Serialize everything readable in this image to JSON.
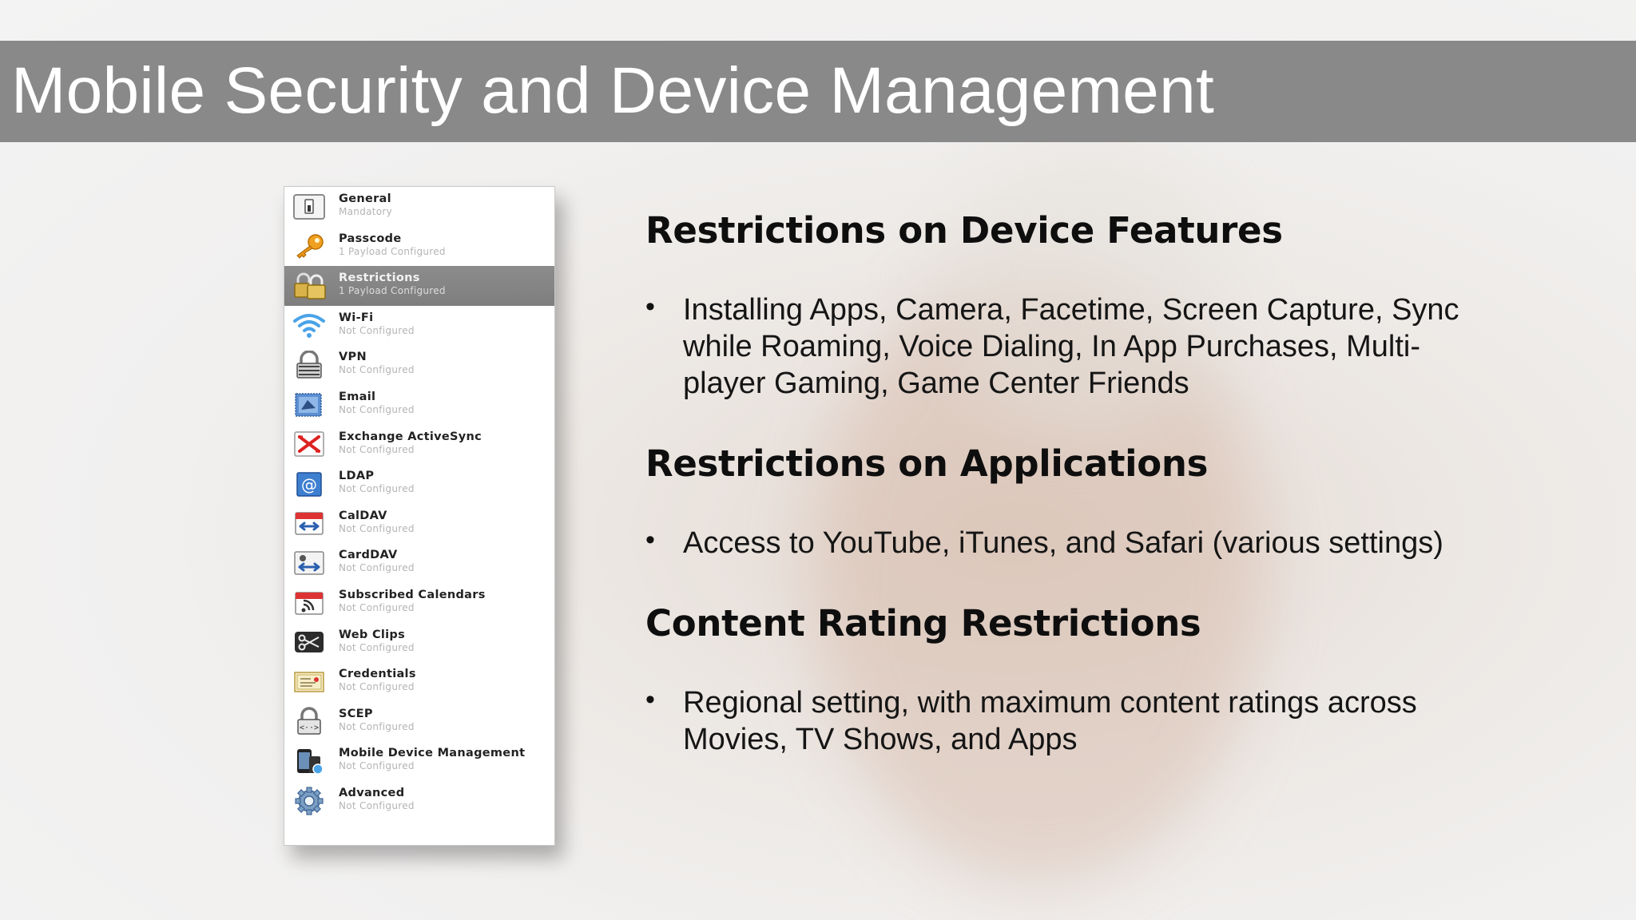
{
  "slide": {
    "title": "Mobile Security and Device Management"
  },
  "sidebar": {
    "items": [
      {
        "name": "General",
        "status": "Mandatory",
        "icon": "general-switch-icon",
        "selected": false
      },
      {
        "name": "Passcode",
        "status": "1 Payload Configured",
        "icon": "key-icon",
        "selected": false
      },
      {
        "name": "Restrictions",
        "status": "1 Payload Configured",
        "icon": "padlocks-icon",
        "selected": true
      },
      {
        "name": "Wi-Fi",
        "status": "Not Configured",
        "icon": "wifi-icon",
        "selected": false
      },
      {
        "name": "VPN",
        "status": "Not Configured",
        "icon": "vpn-lock-icon",
        "selected": false
      },
      {
        "name": "Email",
        "status": "Not Configured",
        "icon": "email-stamp-icon",
        "selected": false
      },
      {
        "name": "Exchange ActiveSync",
        "status": "Not Configured",
        "icon": "exchange-icon",
        "selected": false
      },
      {
        "name": "LDAP",
        "status": "Not Configured",
        "icon": "ldap-at-icon",
        "selected": false
      },
      {
        "name": "CalDAV",
        "status": "Not Configured",
        "icon": "caldav-calendar-icon",
        "selected": false
      },
      {
        "name": "CardDAV",
        "status": "Not Configured",
        "icon": "carddav-card-icon",
        "selected": false
      },
      {
        "name": "Subscribed Calendars",
        "status": "Not Configured",
        "icon": "subscribed-calendar-icon",
        "selected": false
      },
      {
        "name": "Web Clips",
        "status": "Not Configured",
        "icon": "web-clips-scissors-icon",
        "selected": false
      },
      {
        "name": "Credentials",
        "status": "Not Configured",
        "icon": "certificate-icon",
        "selected": false
      },
      {
        "name": "SCEP",
        "status": "Not Configured",
        "icon": "scep-lock-icon",
        "selected": false
      },
      {
        "name": "Mobile Device Management",
        "status": "Not Configured",
        "icon": "mdm-devices-icon",
        "selected": false
      },
      {
        "name": "Advanced",
        "status": "Not Configured",
        "icon": "gear-icon",
        "selected": false
      }
    ]
  },
  "sections": [
    {
      "heading": "Restrictions on Device Features",
      "bullets": [
        "Installing Apps, Camera, Facetime, Screen Capture, Sync while Roaming, Voice Dialing, In App Purchases, Multi-player Gaming, Game Center Friends"
      ]
    },
    {
      "heading": "Restrictions on Applications",
      "bullets": [
        "Access to YouTube, iTunes, and Safari (various settings)"
      ]
    },
    {
      "heading": "Content Rating Restrictions",
      "bullets": [
        "Regional setting, with maximum content ratings across Movies, TV Shows, and Apps"
      ]
    }
  ],
  "colors": {
    "title_bar": "#898989",
    "selected_row": "#848484",
    "text": "#111111"
  }
}
